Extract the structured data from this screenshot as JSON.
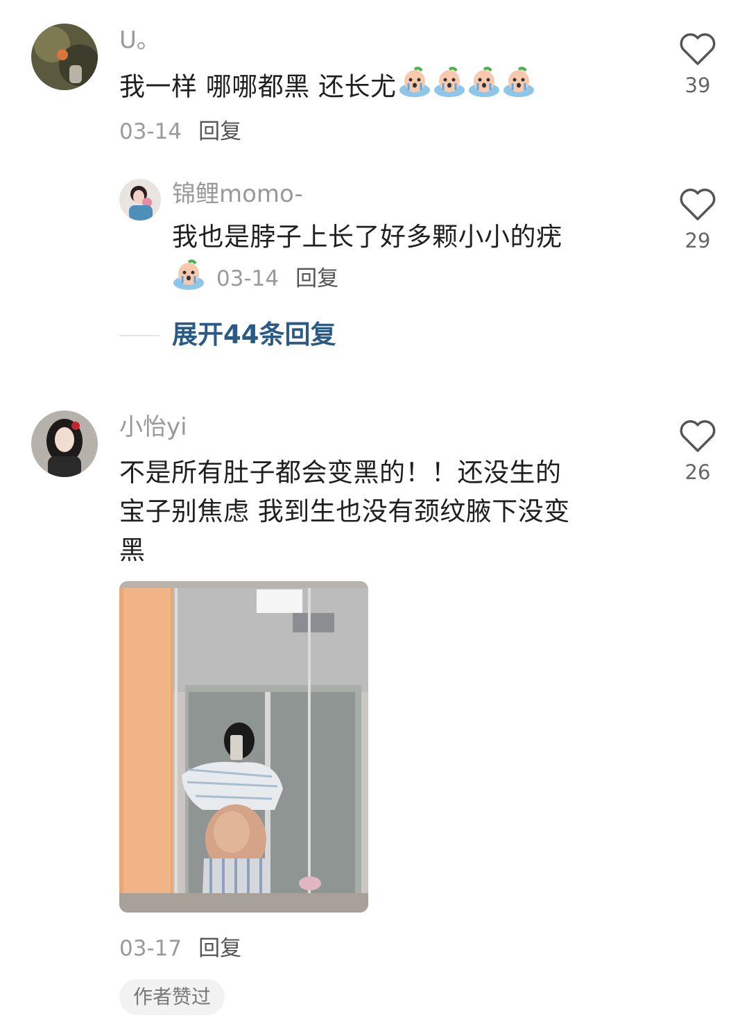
{
  "comments": [
    {
      "username": "U。",
      "text": "我一样 哪哪都黑 还长尤",
      "emoji_icons": [
        "crying-emoji-icon",
        "crying-emoji-icon",
        "crying-emoji-icon",
        "crying-emoji-icon"
      ],
      "date": "03-14",
      "reply_label": "回复",
      "likes": "39",
      "replies": [
        {
          "username": "锦鲤momo-",
          "text": "我也是脖子上长了好多颗小小的疣",
          "emoji_icons": [
            "crying-emoji-icon"
          ],
          "date": "03-14",
          "reply_label": "回复",
          "likes": "29"
        }
      ],
      "expand_label": "展开44条回复"
    },
    {
      "username": "小怡yi",
      "text_lines": [
        "不是所有肚子都会变黑的！！还没生的",
        "宝子别焦虑 我到生也没有颈纹腋下没变",
        "黑"
      ],
      "image_icon": "mirror-selfie-photo",
      "date": "03-17",
      "reply_label": "回复",
      "likes": "26",
      "author_liked_badge": "作者赞过"
    }
  ],
  "colors": {
    "accent_link": "#2c5a86",
    "meta_gray": "#9a9a9a",
    "badge_bg": "#f2f2f2"
  }
}
